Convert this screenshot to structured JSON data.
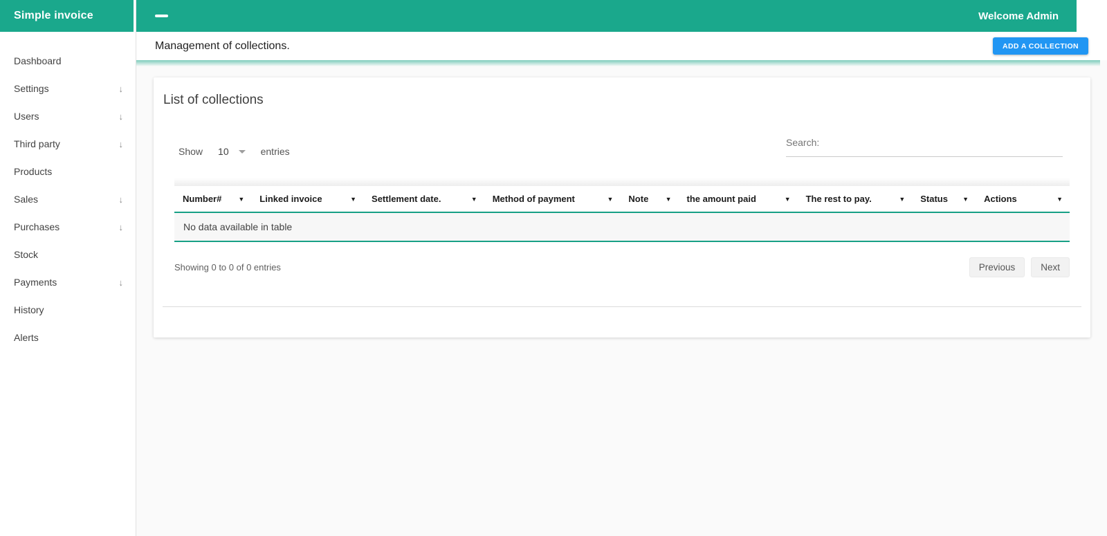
{
  "app": {
    "brand": "Simple invoice",
    "welcome": "Welcome Admin",
    "page_title": "Management of collections.",
    "add_button_label": "ADD A COLLECTION"
  },
  "colors": {
    "accent_teal": "#1aa88c",
    "table_border_teal": "#17a085",
    "add_button_blue": "#2196f3"
  },
  "icons": {
    "menu_toggle": "dash-icon",
    "sidebar_expand": "arrow-down-icon",
    "column_sort": "triangle-down-icon",
    "length_select": "triangle-down-icon"
  },
  "sidebar": {
    "items": [
      {
        "label": "Dashboard",
        "expandable": false
      },
      {
        "label": "Settings",
        "expandable": true
      },
      {
        "label": "Users",
        "expandable": true
      },
      {
        "label": "Third party",
        "expandable": true
      },
      {
        "label": "Products",
        "expandable": false
      },
      {
        "label": "Sales",
        "expandable": true
      },
      {
        "label": "Purchases",
        "expandable": true
      },
      {
        "label": "Stock",
        "expandable": false
      },
      {
        "label": "Payments",
        "expandable": true
      },
      {
        "label": "History",
        "expandable": false
      },
      {
        "label": "Alerts",
        "expandable": false
      }
    ]
  },
  "card": {
    "title": "List of collections",
    "length_control": {
      "before": "Show",
      "value": "10",
      "after": "entries"
    },
    "search": {
      "label": "Search:",
      "value": ""
    },
    "table": {
      "columns": [
        "Number#",
        "Linked invoice",
        "Settlement date.",
        "Method of payment",
        "Note",
        "the amount paid",
        "The rest to pay.",
        "Status",
        "Actions"
      ],
      "empty_text": "No data available in table",
      "rows": []
    },
    "info": "Showing 0 to 0 of 0 entries",
    "pagination": {
      "previous": "Previous",
      "next": "Next"
    }
  }
}
